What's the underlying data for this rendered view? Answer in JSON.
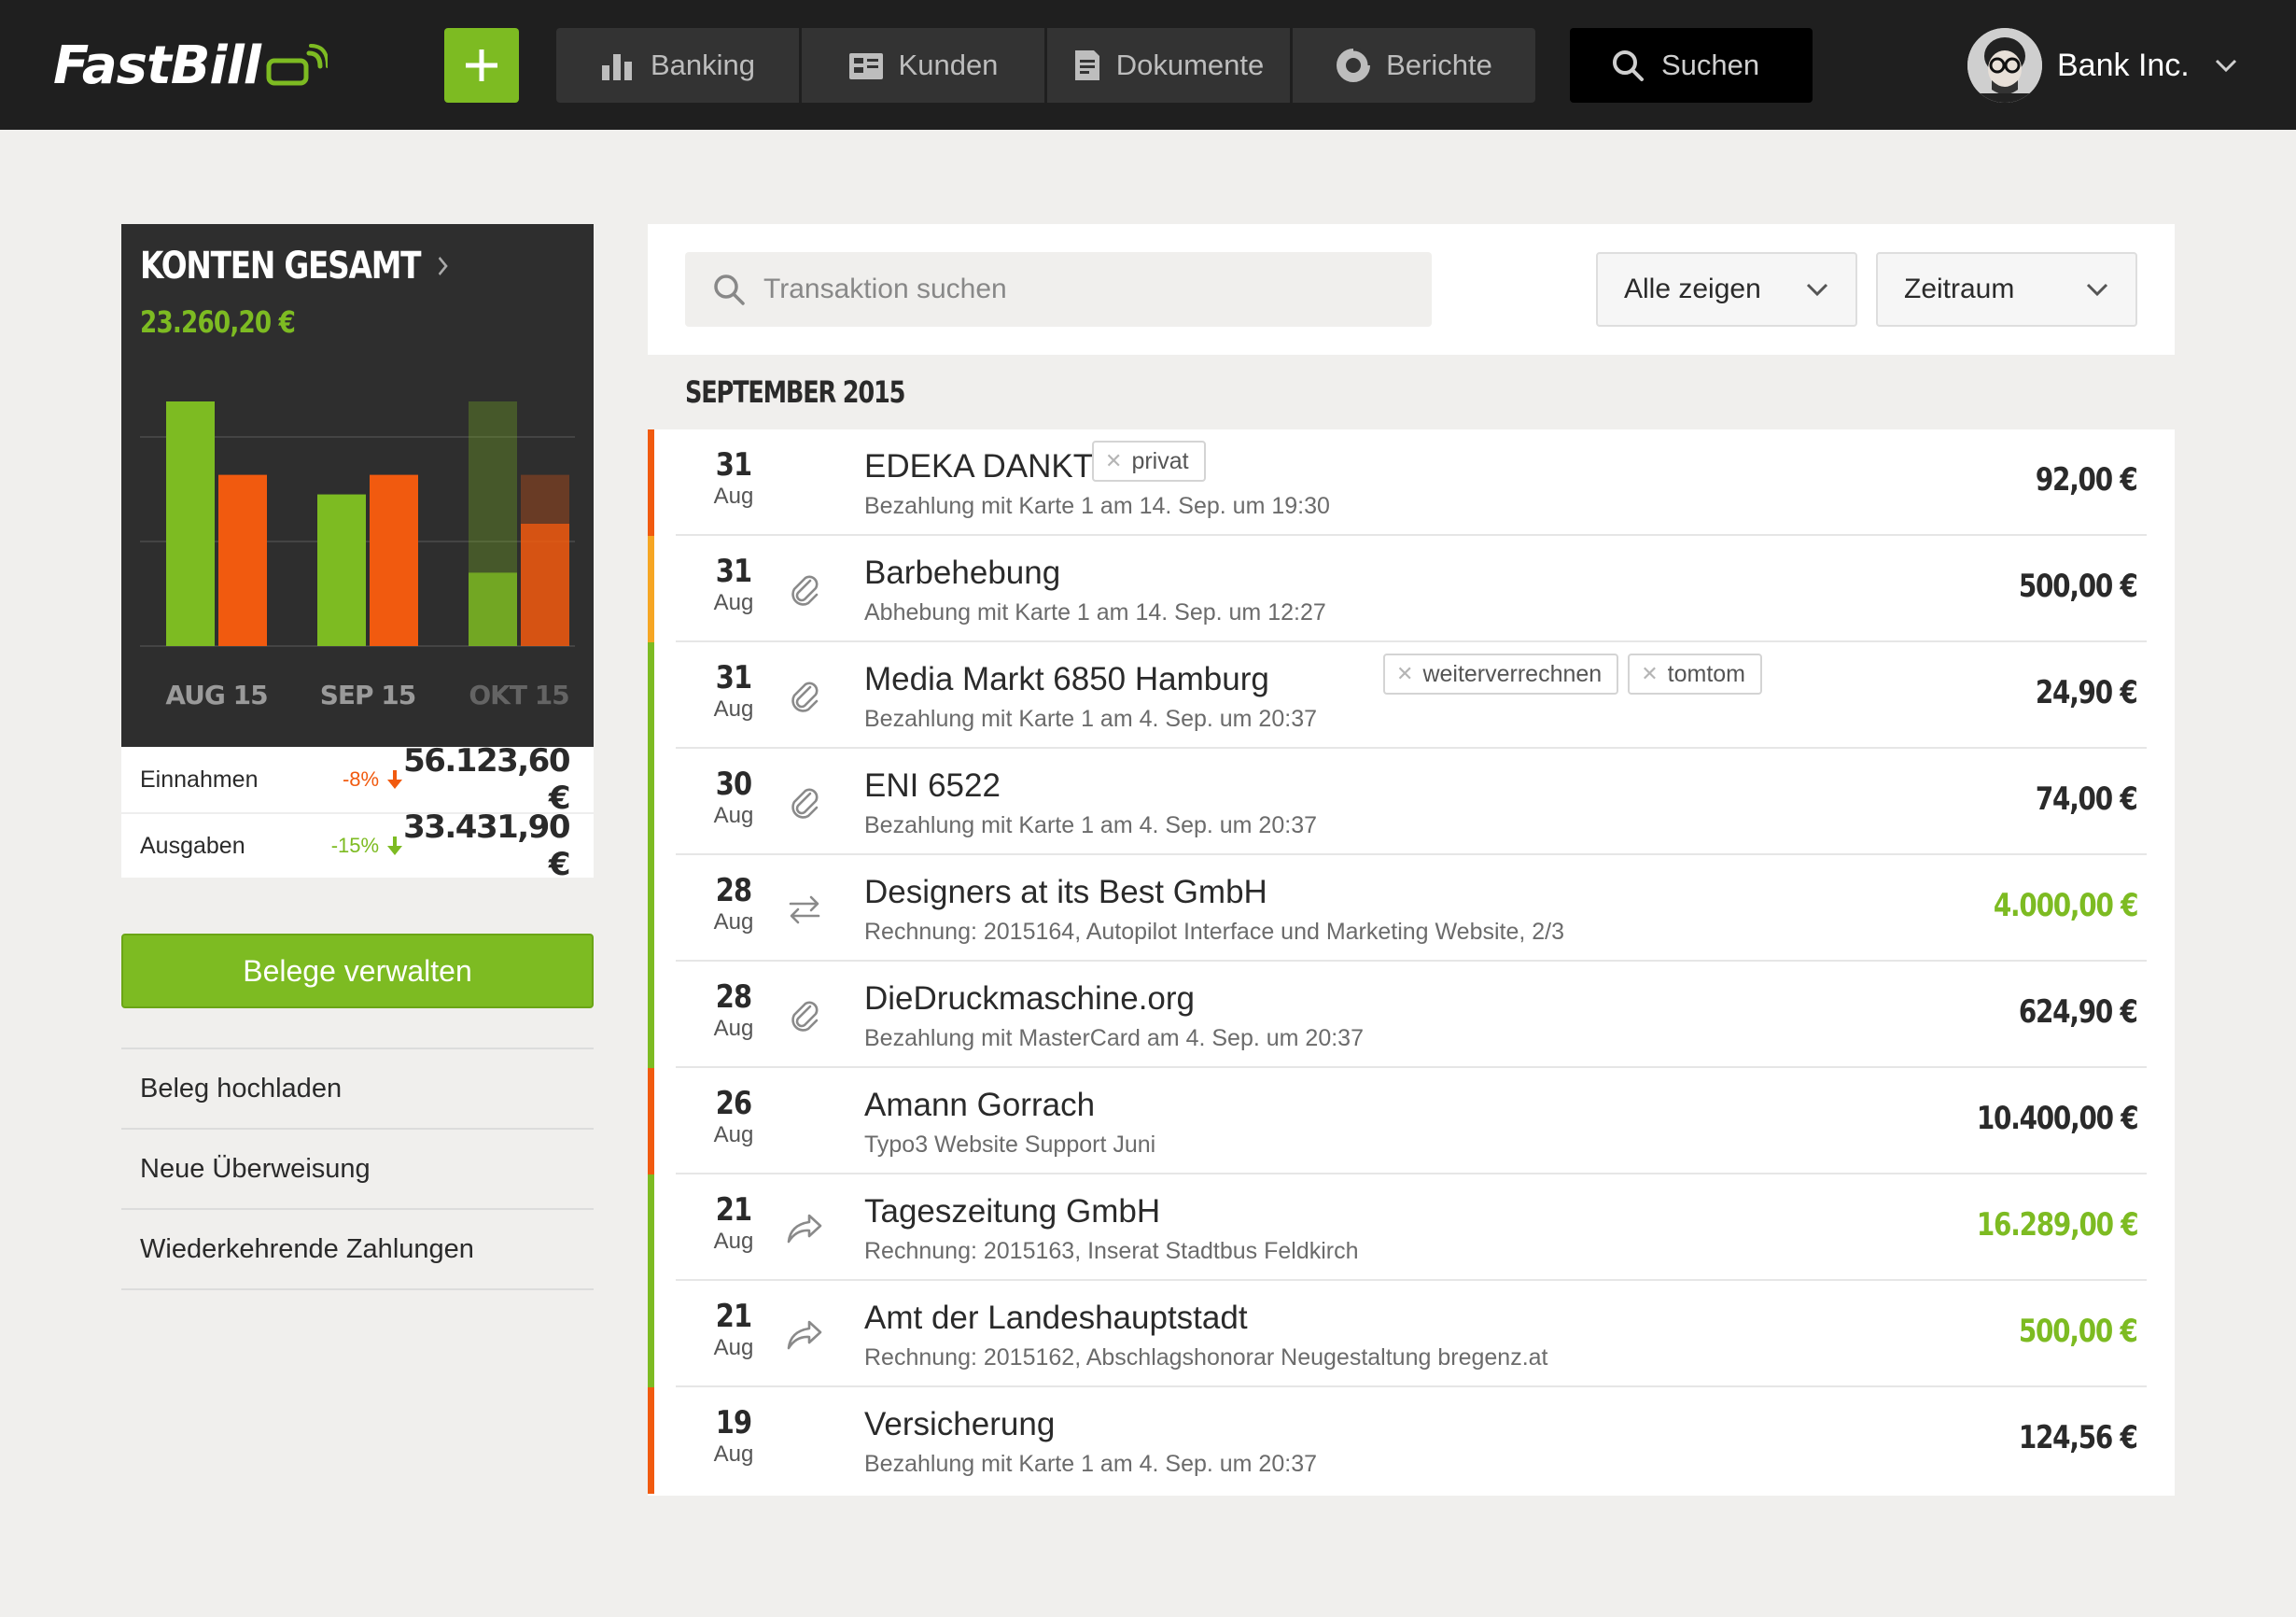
{
  "colors": {
    "brand_green": "#7dbb22",
    "expense_orange": "#f15a0f",
    "pending_amber": "#f6a623",
    "topbar": "#1f1f1f"
  },
  "header": {
    "logo_text": "FastBill",
    "add_icon": "plus-icon",
    "nav": [
      {
        "label": "Banking",
        "icon": "bar-chart-icon"
      },
      {
        "label": "Kunden",
        "icon": "contacts-icon"
      },
      {
        "label": "Dokumente",
        "icon": "document-icon"
      },
      {
        "label": "Berichte",
        "icon": "donut-chart-icon"
      }
    ],
    "search_label": "Suchen",
    "user_name": "Bank Inc."
  },
  "accounts": {
    "title": "KONTEN GESAMT",
    "total": "23.260,20 €",
    "stats": [
      {
        "label": "Einnahmen",
        "pct": "-8%",
        "trend": "down",
        "value": "56.123,60 €"
      },
      {
        "label": "Ausgaben",
        "pct": "-15%",
        "trend": "down",
        "value": "33.431,90 €"
      }
    ]
  },
  "chart_data": {
    "type": "bar",
    "categories": [
      "AUG 15",
      "SEP 15",
      "OKT 15"
    ],
    "series": [
      {
        "values": [
          100,
          62,
          100
        ],
        "color": "#7dbb22"
      },
      {
        "values": [
          70,
          70,
          70
        ],
        "color": "#f15a0f"
      }
    ],
    "solid_values": [
      [
        100,
        62,
        30
      ],
      [
        70,
        70,
        50
      ]
    ],
    "ylim": [
      0,
      100
    ],
    "grid": true,
    "legend": "none"
  },
  "sidebar": {
    "primary_button": "Belege verwalten",
    "links": [
      "Beleg hochladen",
      "Neue Überweisung",
      "Wiederkehrende Zahlungen"
    ]
  },
  "filters": {
    "search_placeholder": "Transaktion suchen",
    "show": "Alle zeigen",
    "period": "Zeitraum"
  },
  "month_label": "SEPTEMBER 2015",
  "transactions": [
    {
      "day": "31",
      "month": "Aug",
      "title": "EDEKA DANKT",
      "subtitle": "Bezahlung mit Karte 1 am 14. Sep. um 19:30",
      "amount": "92,00 €",
      "status": "expense",
      "icon": "",
      "tags": [
        "privat"
      ]
    },
    {
      "day": "31",
      "month": "Aug",
      "title": "Barbehebung",
      "subtitle": "Abhebung mit Karte 1 am 14. Sep. um 12:27",
      "amount": "500,00 €",
      "status": "pending",
      "icon": "paperclip-icon",
      "tags": []
    },
    {
      "day": "31",
      "month": "Aug",
      "title": "Media Markt 6850 Hamburg",
      "subtitle": "Bezahlung mit Karte 1 am 4. Sep. um 20:37",
      "amount": "24,90 €",
      "status": "matched",
      "icon": "paperclip-icon",
      "tags": [
        "weiterverrechnen",
        "tomtom"
      ]
    },
    {
      "day": "30",
      "month": "Aug",
      "title": "ENI 6522",
      "subtitle": "Bezahlung mit Karte 1 am 4. Sep. um 20:37",
      "amount": "74,00 €",
      "status": "matched",
      "icon": "paperclip-icon",
      "tags": []
    },
    {
      "day": "28",
      "month": "Aug",
      "title": "Designers at its Best GmbH",
      "subtitle": "Rechnung: 2015164, Autopilot Interface und Marketing Website, 2/3",
      "amount": "4.000,00 €",
      "status": "matched",
      "income": true,
      "icon": "recurring-icon",
      "tags": []
    },
    {
      "day": "28",
      "month": "Aug",
      "title": "DieDruckmaschine.org",
      "subtitle": "Bezahlung mit MasterCard am 4. Sep. um 20:37",
      "amount": "624,90 €",
      "status": "matched",
      "icon": "paperclip-icon",
      "tags": []
    },
    {
      "day": "26",
      "month": "Aug",
      "title": "Amann Gorrach",
      "subtitle": "Typo3 Website Support Juni",
      "amount": "10.400,00 €",
      "status": "expense",
      "icon": "",
      "tags": []
    },
    {
      "day": "21",
      "month": "Aug",
      "title": "Tageszeitung GmbH",
      "subtitle": "Rechnung: 2015163, Inserat Stadtbus Feldkirch",
      "amount": "16.289,00 €",
      "status": "matched",
      "income": true,
      "icon": "forward-icon",
      "tags": []
    },
    {
      "day": "21",
      "month": "Aug",
      "title": "Amt der Landeshauptstadt",
      "subtitle": "Rechnung: 2015162, Abschlagshonorar Neugestaltung bregenz.at",
      "amount": "500,00 €",
      "status": "matched",
      "income": true,
      "icon": "forward-icon",
      "tags": []
    },
    {
      "day": "19",
      "month": "Aug",
      "title": "Versicherung",
      "subtitle": "Bezahlung mit Karte 1 am 4. Sep. um 20:37",
      "amount": "124,56 €",
      "status": "expense",
      "icon": "",
      "tags": []
    }
  ]
}
